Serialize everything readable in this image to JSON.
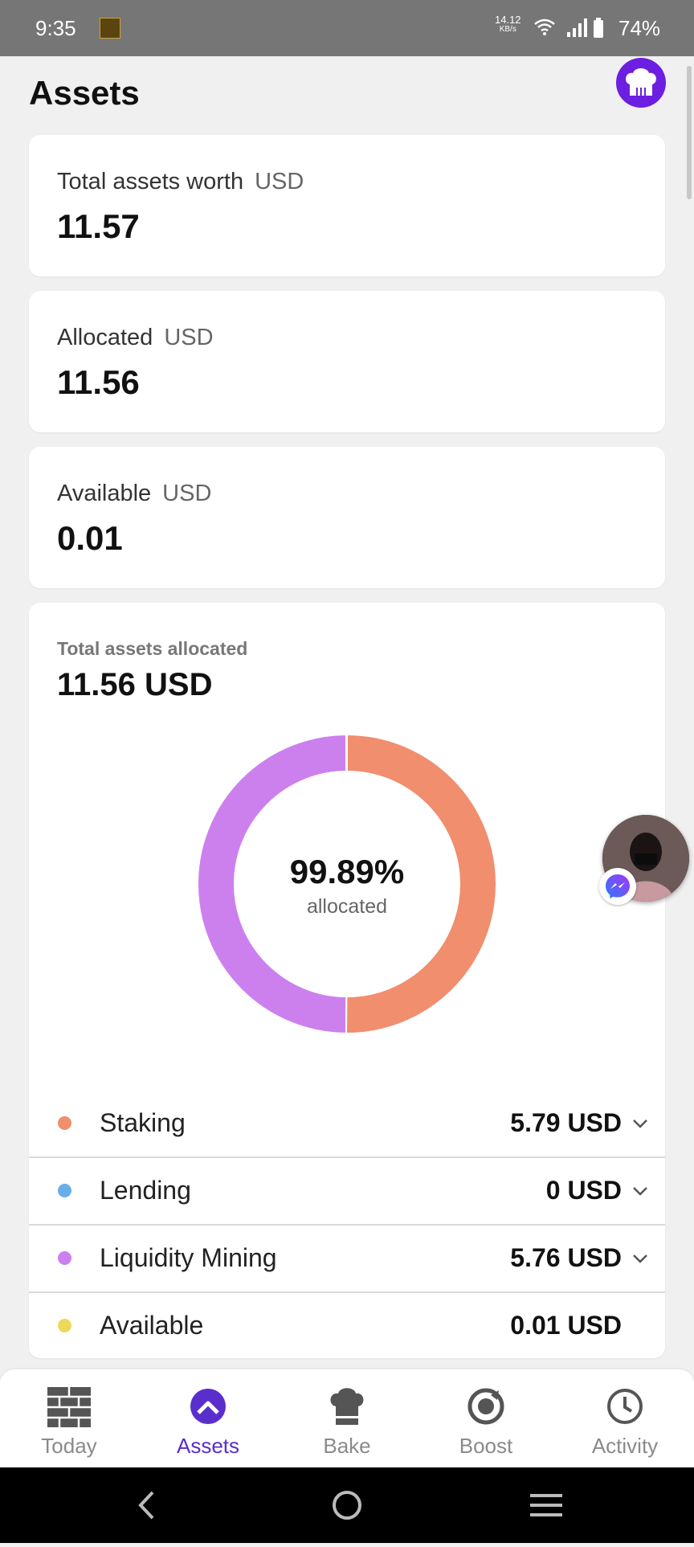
{
  "status_bar": {
    "time": "9:35",
    "net_speed_value": "14.12",
    "net_speed_unit": "KB/s",
    "battery": "74%",
    "icons": [
      "app-notification-icon",
      "wifi-icon",
      "signal-icon",
      "battery-icon"
    ]
  },
  "header": {
    "title": "Assets",
    "profile_icon": "chef-hat-icon"
  },
  "cards": {
    "total": {
      "label": "Total assets worth",
      "unit": "USD",
      "value": "11.57"
    },
    "allocated": {
      "label": "Allocated",
      "unit": "USD",
      "value": "11.56"
    },
    "available": {
      "label": "Available",
      "unit": "USD",
      "value": "0.01"
    }
  },
  "allocation": {
    "title": "Total assets allocated",
    "total": "11.56 USD",
    "center_percent": "99.89%",
    "center_label": "allocated",
    "legend": [
      {
        "name": "Staking",
        "value": "5.79 USD",
        "color": "#f08e6e",
        "expandable": true
      },
      {
        "name": "Lending",
        "value": "0 USD",
        "color": "#6aaee8",
        "expandable": true
      },
      {
        "name": "Liquidity Mining",
        "value": "5.76 USD",
        "color": "#cc80ee",
        "expandable": true
      },
      {
        "name": "Available",
        "value": "0.01 USD",
        "color": "#eed85a",
        "expandable": false
      }
    ]
  },
  "chart_data": {
    "type": "pie",
    "categories": [
      "Staking",
      "Lending",
      "Liquidity Mining",
      "Available"
    ],
    "values": [
      5.79,
      0,
      5.76,
      0.01
    ],
    "colors": [
      "#f08e6e",
      "#6aaee8",
      "#cc80ee",
      "#eed85a"
    ],
    "title": "Total assets allocated",
    "center_text": "99.89%"
  },
  "bottom_nav": [
    {
      "label": "Today",
      "icon": "brick-wall-icon",
      "active": false
    },
    {
      "label": "Assets",
      "icon": "assets-chevron-icon",
      "active": true
    },
    {
      "label": "Bake",
      "icon": "chef-hat-icon",
      "active": false
    },
    {
      "label": "Boost",
      "icon": "boost-icon",
      "active": false
    },
    {
      "label": "Activity",
      "icon": "clock-icon",
      "active": false
    }
  ],
  "colors": {
    "accent": "#5a2ecc",
    "profile_button": "#6c1fe0",
    "status_bar": "#767676",
    "background": "#f0f0f0"
  }
}
